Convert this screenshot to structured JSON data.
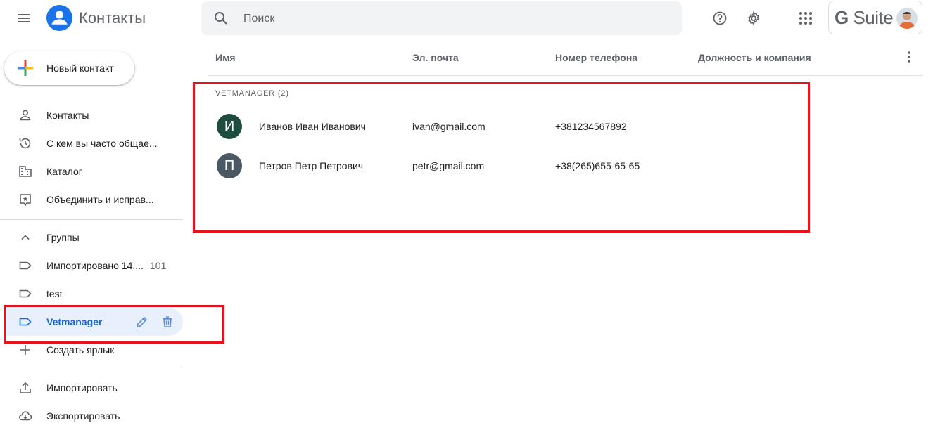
{
  "header": {
    "app_title": "Контакты",
    "search_placeholder": "Поиск",
    "gsuite_g": "G",
    "gsuite_rest": " Suite"
  },
  "sidebar": {
    "new_contact_label": "Новый контакт",
    "items": [
      {
        "label": "Контакты",
        "icon": "person-icon"
      },
      {
        "label": "С кем вы часто общае...",
        "icon": "history-icon"
      },
      {
        "label": "Каталог",
        "icon": "directory-icon"
      },
      {
        "label": "Объединить и исправ...",
        "icon": "merge-fix-icon"
      }
    ],
    "groups_header": "Группы",
    "labels": [
      {
        "label": "Импортировано 14....",
        "count": "101"
      },
      {
        "label": "test",
        "count": ""
      },
      {
        "label": "Vetmanager",
        "count": "",
        "active": true
      }
    ],
    "create_label": "Создать ярлык",
    "import_label": "Импортировать",
    "export_label": "Экспортировать"
  },
  "table": {
    "columns": [
      "Имя",
      "Эл. почта",
      "Номер телефона",
      "Должность и компания"
    ],
    "group_label": "VETMANAGER (2)",
    "rows": [
      {
        "initial": "И",
        "name": "Иванов Иван Иванович",
        "email": "ivan@gmail.com",
        "phone": "+381234567892",
        "avatar_color": "#1e4d40"
      },
      {
        "initial": "П",
        "name": "Петров Петр Петрович",
        "email": "petr@gmail.com",
        "phone": "+38(265)655-65-65",
        "avatar_color": "#4a5863"
      }
    ]
  },
  "colors": {
    "accent": "#1a73e8",
    "active_bg": "#e8f0fe",
    "highlight": "#e8111c"
  }
}
